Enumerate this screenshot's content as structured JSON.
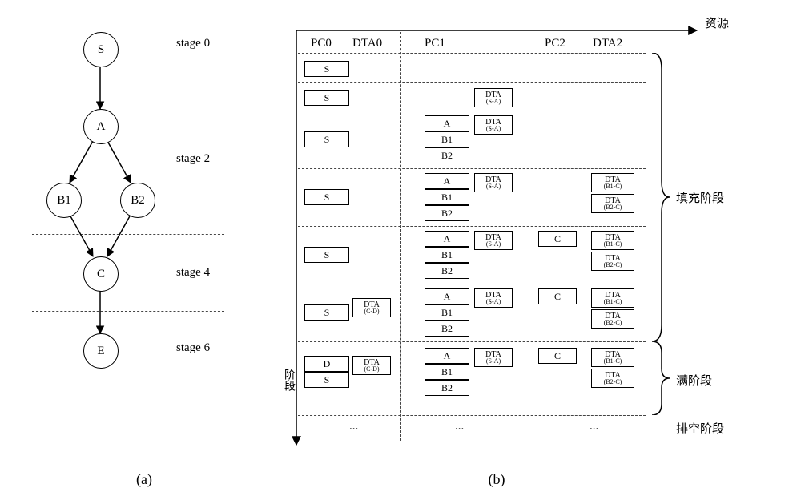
{
  "panel_a": {
    "nodes": {
      "S": "S",
      "A": "A",
      "B1": "B1",
      "B2": "B2",
      "C": "C",
      "E": "E"
    },
    "stage_labels": {
      "s0": "stage 0",
      "s2": "stage 2",
      "s4": "stage 4",
      "s6": "stage 6"
    },
    "fig_label": "(a)"
  },
  "panel_b": {
    "axis_x": "资源",
    "axis_y": "阶段",
    "columns": {
      "pc0": "PC0",
      "dta0": "DTA0",
      "pc1": "PC1",
      "pc2": "PC2",
      "dta2": "DTA2"
    },
    "tokens": {
      "S": "S",
      "A": "A",
      "B1": "B1",
      "B2": "B2",
      "C": "C",
      "D": "D",
      "DTA": "DTA",
      "SA": "(S-A)",
      "B1C": "(B1-C)",
      "B2C": "(B2-C)",
      "CD": "(C-D)"
    },
    "phases": {
      "fill": "填充阶段",
      "full": "满阶段",
      "drain": "排空阶段"
    },
    "ellipsis": "...",
    "fig_label": "(b)"
  }
}
